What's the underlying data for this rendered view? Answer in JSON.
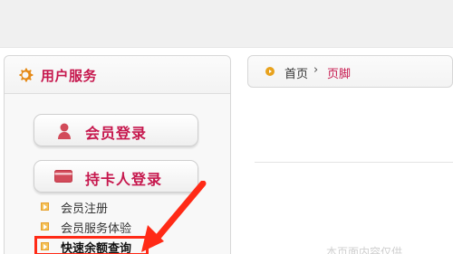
{
  "sidebar": {
    "title": "用户服务",
    "buttons": [
      {
        "label": "会员登录",
        "icon": "user-icon"
      },
      {
        "label": "持卡人登录",
        "icon": "card-icon"
      }
    ],
    "links": [
      {
        "label": "会员注册"
      },
      {
        "label": "会员服务体验"
      },
      {
        "label": "快速余额查询",
        "highlighted": true
      }
    ]
  },
  "breadcrumb": {
    "home": "首页",
    "separator": "›",
    "current": "页脚"
  },
  "bottom_text": "本页面内容仅供...",
  "colors": {
    "accent": "#c6174d",
    "highlight_red": "#ff2a16",
    "icon_orange": "#f4c25b"
  }
}
